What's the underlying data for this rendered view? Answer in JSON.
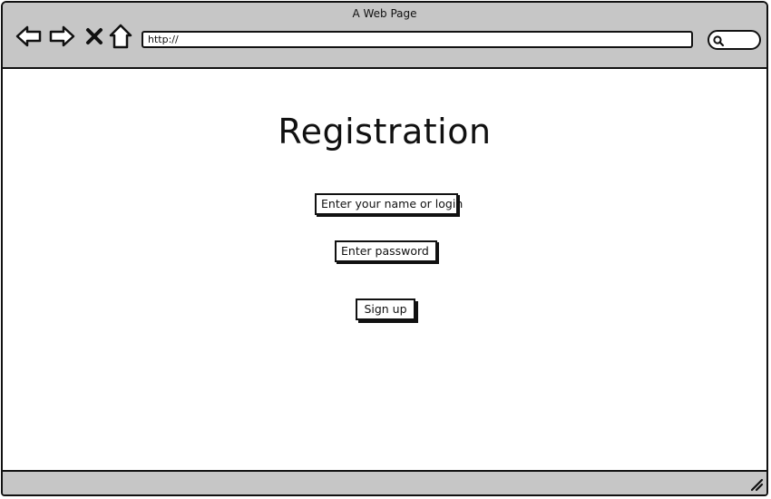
{
  "window": {
    "title": "A Web Page"
  },
  "toolbar": {
    "icons": [
      "back-arrow-icon",
      "forward-arrow-icon",
      "close-x-icon",
      "home-icon"
    ],
    "address_value": "http://",
    "search_icon": "search-icon"
  },
  "form": {
    "title": "Registration",
    "name_field": "Enter your name or login",
    "password_field": "Enter password",
    "signup_label": "Sign up"
  },
  "status_bar": {
    "grip_icon": "resize-grip-icon"
  }
}
